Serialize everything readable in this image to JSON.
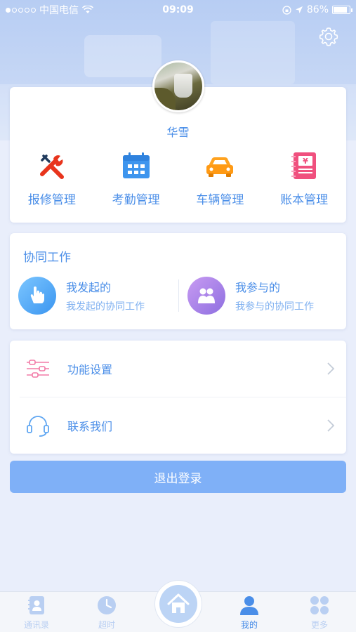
{
  "status_bar": {
    "carrier": "中国电信",
    "time": "09:09",
    "battery_text": "86%",
    "battery_level": 0.86
  },
  "profile": {
    "name": "华雪"
  },
  "quick_menu": [
    {
      "label": "报修管理",
      "icon": "repair-tools-icon"
    },
    {
      "label": "考勤管理",
      "icon": "calendar-icon"
    },
    {
      "label": "车辆管理",
      "icon": "car-icon"
    },
    {
      "label": "账本管理",
      "icon": "ledger-icon"
    }
  ],
  "collab": {
    "title": "协同工作",
    "initiated": {
      "title": "我发起的",
      "subtitle": "我发起的协同工作",
      "icon": "hand-tap-icon"
    },
    "participated": {
      "title": "我参与的",
      "subtitle": "我参与的协同工作",
      "icon": "people-icon"
    }
  },
  "settings": [
    {
      "label": "功能设置",
      "icon": "sliders-icon"
    },
    {
      "label": "联系我们",
      "icon": "headset-icon"
    }
  ],
  "logout_label": "退出登录",
  "tabbar": [
    {
      "label": "通讯录",
      "icon": "contacts-icon",
      "active": false
    },
    {
      "label": "超时",
      "icon": "clock-icon",
      "active": false
    },
    {
      "label": "我的",
      "icon": "person-icon",
      "active": true
    },
    {
      "label": "更多",
      "icon": "grid-icon",
      "active": false
    }
  ],
  "colors": {
    "accent": "#4a8ee8",
    "logout_bg": "#7fb0f7",
    "background": "#e9eefb"
  }
}
